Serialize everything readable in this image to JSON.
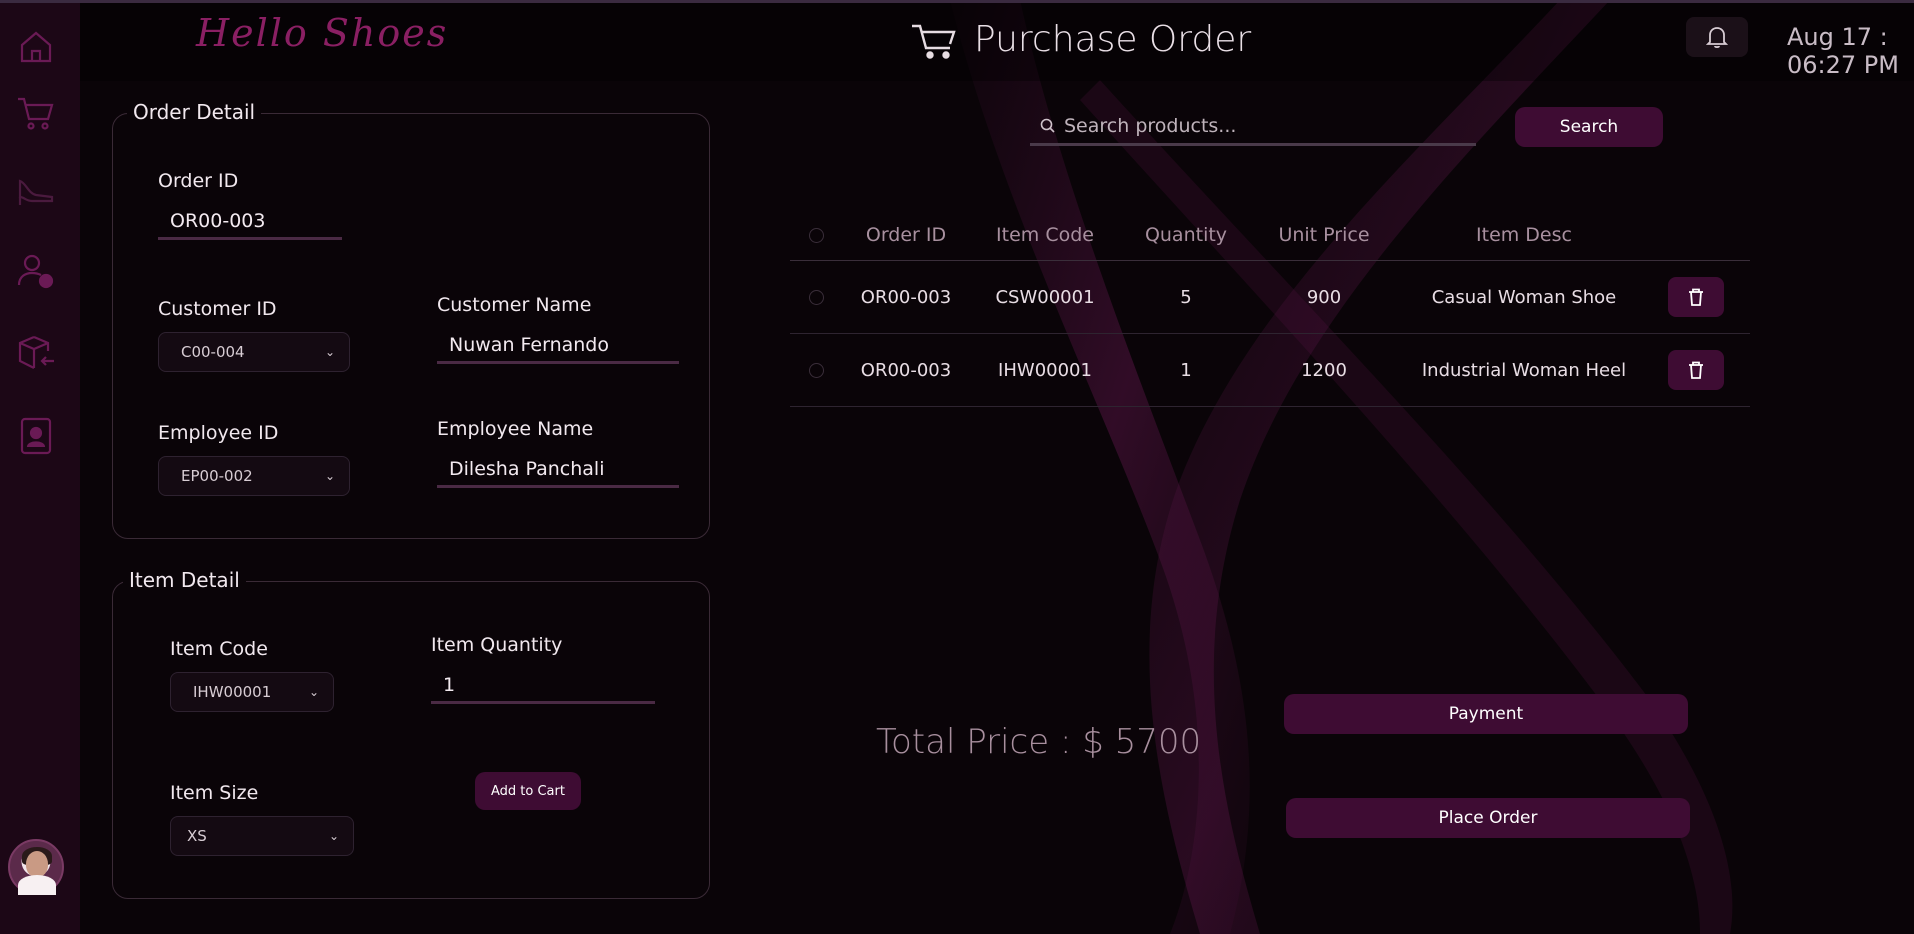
{
  "app": {
    "logo_text": "Hello Shoes",
    "page_title": "Purchase Order",
    "datetime": "Aug 17 : 06:27 PM"
  },
  "sidebar": {
    "items": [
      {
        "icon": "home-icon"
      },
      {
        "icon": "cart-icon"
      },
      {
        "icon": "heel-shoe-icon"
      },
      {
        "icon": "user-clock-icon"
      },
      {
        "icon": "box-return-icon"
      },
      {
        "icon": "id-badge-icon"
      }
    ]
  },
  "order_detail": {
    "legend": "Order Detail",
    "order_id_label": "Order ID",
    "order_id_value": "OR00-003",
    "customer_id_label": "Customer ID",
    "customer_id_value": "C00-004",
    "customer_name_label": "Customer Name",
    "customer_name_value": "Nuwan Fernando",
    "employee_id_label": "Employee ID",
    "employee_id_value": "EP00-002",
    "employee_name_label": "Employee Name",
    "employee_name_value": "Dilesha Panchali"
  },
  "item_detail": {
    "legend": "Item Detail",
    "item_code_label": "Item Code",
    "item_code_value": "IHW00001",
    "item_quantity_label": "Item Quantity",
    "item_quantity_value": "1",
    "item_size_label": "Item Size",
    "item_size_value": "XS",
    "add_to_cart_label": "Add to Cart"
  },
  "search": {
    "placeholder": "Search products...",
    "button_label": "Search"
  },
  "table": {
    "columns": [
      "Order ID",
      "Item Code",
      "Quantity",
      "Unit Price",
      "Item Desc"
    ],
    "rows": [
      {
        "order_id": "OR00-003",
        "item_code": "CSW00001",
        "quantity": "5",
        "unit_price": "900",
        "item_desc": "Casual Woman Shoe"
      },
      {
        "order_id": "OR00-003",
        "item_code": "IHW00001",
        "quantity": "1",
        "unit_price": "1200",
        "item_desc": "Industrial Woman Heel"
      }
    ]
  },
  "summary": {
    "total_text": "Total Price : $ 5700",
    "payment_label": "Payment",
    "place_order_label": "Place Order"
  },
  "colors": {
    "accent": "#3e0c33",
    "sidebar": "#1c0716",
    "background": "#0a0408",
    "brand": "#8a1f63"
  }
}
